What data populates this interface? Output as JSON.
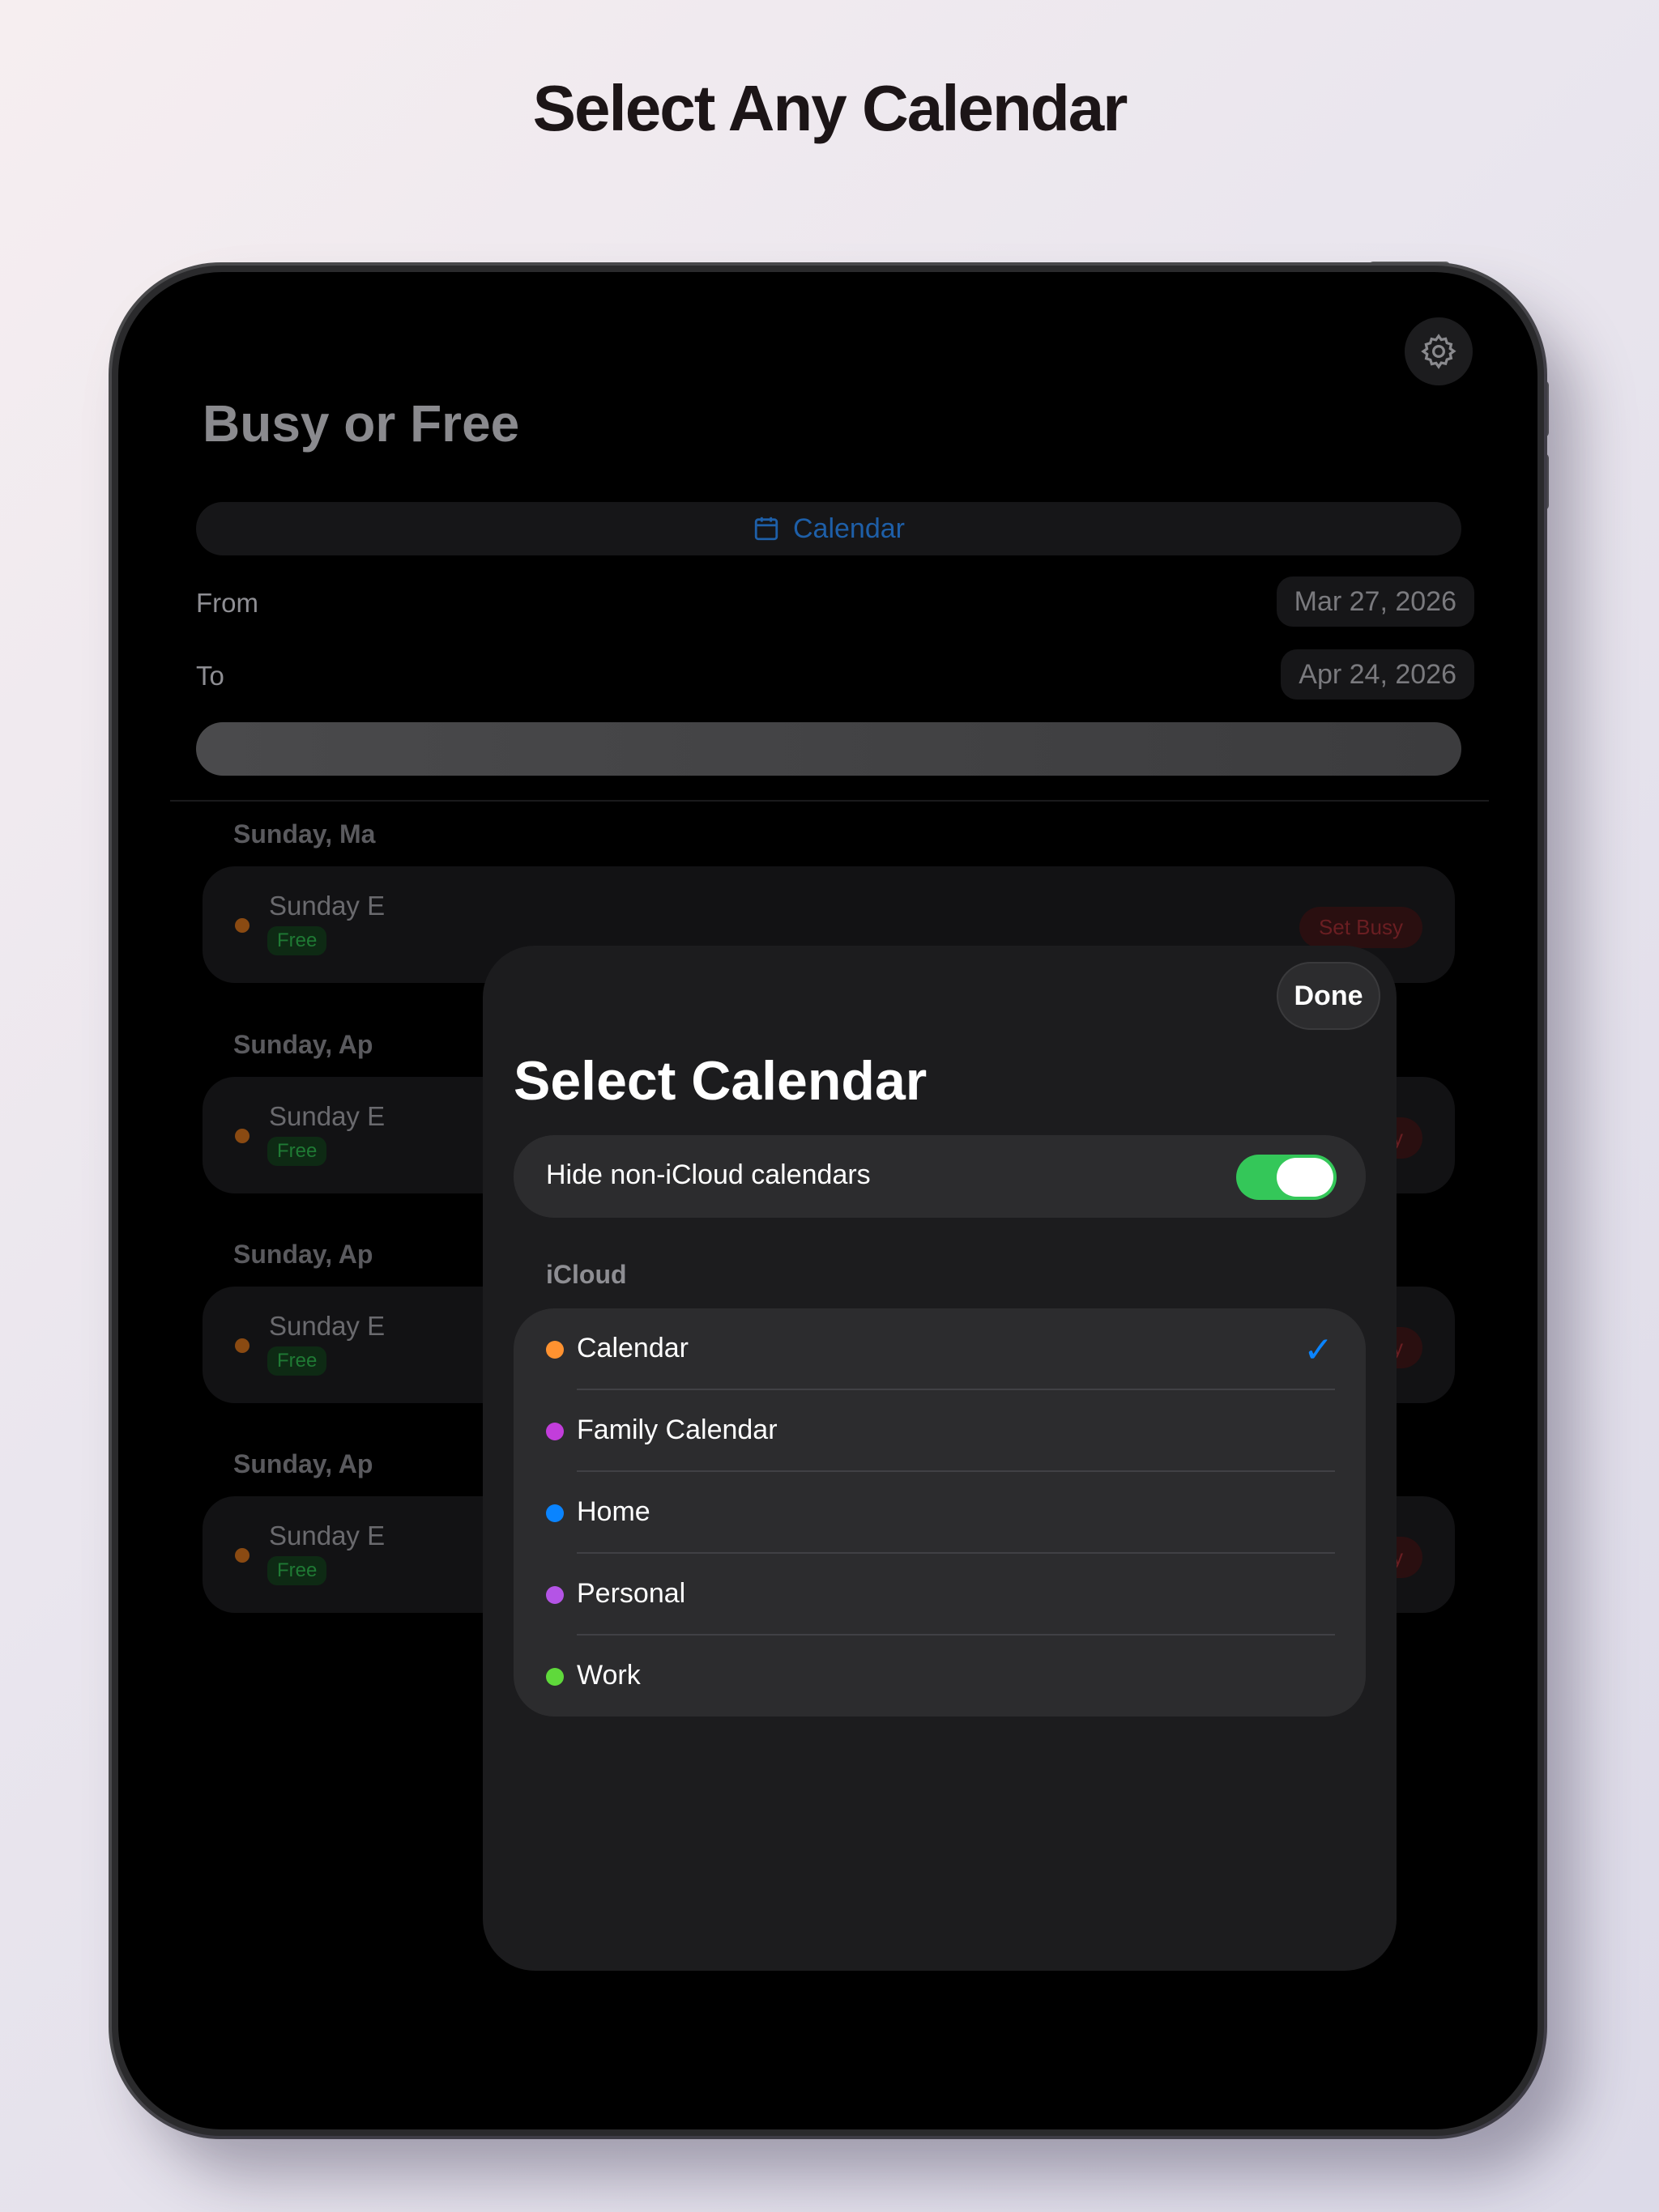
{
  "headline": "Select Any Calendar",
  "app": {
    "title": "Busy or Free",
    "calendar_button": "Calendar",
    "from_label": "From",
    "from_date": "Mar 27, 2026",
    "to_label": "To",
    "to_date": "Apr 24, 2026",
    "sections": [
      {
        "header": "Sunday, Ma",
        "event": "Sunday E",
        "status": "Free",
        "action": "Set Busy"
      },
      {
        "header": "Sunday, Ap",
        "event": "Sunday E",
        "status": "Free",
        "action": "Set Busy"
      },
      {
        "header": "Sunday, Ap",
        "event": "Sunday E",
        "status": "Free",
        "action": "Set Busy"
      },
      {
        "header": "Sunday, Ap",
        "event": "Sunday E",
        "status": "Free",
        "action": "Set Busy"
      }
    ]
  },
  "modal": {
    "done": "Done",
    "title": "Select Calendar",
    "toggle_label": "Hide non-iCloud calendars",
    "toggle_on": true,
    "group": "iCloud",
    "calendars": [
      {
        "name": "Calendar",
        "color": "#ff9230",
        "selected": true
      },
      {
        "name": "Family Calendar",
        "color": "#c23ddb",
        "selected": false
      },
      {
        "name": "Home",
        "color": "#0a84ff",
        "selected": false
      },
      {
        "name": "Personal",
        "color": "#b454e6",
        "selected": false
      },
      {
        "name": "Work",
        "color": "#5fd93b",
        "selected": false
      }
    ],
    "check_glyph": "✓"
  }
}
